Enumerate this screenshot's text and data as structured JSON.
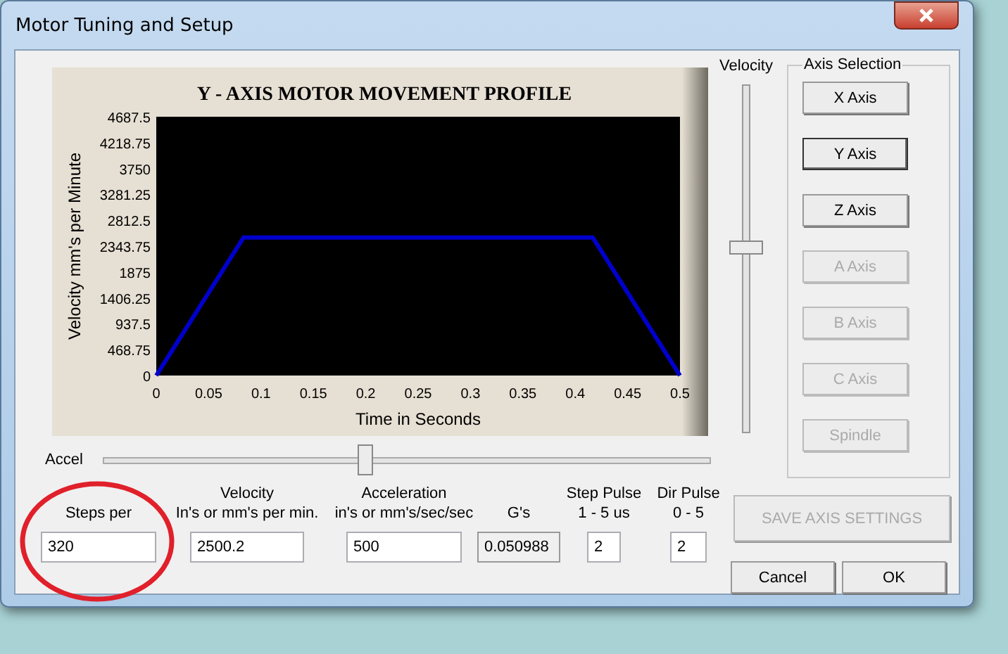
{
  "window": {
    "title": "Motor Tuning and Setup"
  },
  "chart": {
    "chart_data": {
      "type": "line",
      "title": "Y - AXIS MOTOR MOVEMENT PROFILE",
      "xlabel": "Time in Seconds",
      "ylabel": "Velocity mm's per Minute",
      "x": [
        0,
        0.0833,
        0.4167,
        0.5
      ],
      "series": [
        {
          "color": "#0000cc",
          "values": [
            0,
            2500,
            2500,
            0
          ]
        }
      ],
      "xlim": [
        0,
        0.5
      ],
      "ylim": [
        0,
        4687.5
      ],
      "xticks": [
        0,
        0.05,
        0.1,
        0.15,
        0.2,
        0.25,
        0.3,
        0.35,
        0.4,
        0.45,
        0.5
      ],
      "yticks": [
        0,
        468.75,
        937.5,
        1406.25,
        1875,
        2343.75,
        2812.5,
        3281.25,
        3750,
        4218.75,
        4687.5
      ]
    }
  },
  "velocity_slider": {
    "label": "Velocity",
    "level": 0.53
  },
  "accel_slider": {
    "label": "Accel",
    "level": 0.43
  },
  "axis_selection": {
    "title": "Axis Selection",
    "buttons": [
      {
        "label": "X Axis",
        "selected": false,
        "disabled": false
      },
      {
        "label": "Y Axis",
        "selected": true,
        "disabled": false
      },
      {
        "label": "Z Axis",
        "selected": false,
        "disabled": false
      },
      {
        "label": "A Axis",
        "selected": false,
        "disabled": true
      },
      {
        "label": "B Axis",
        "selected": false,
        "disabled": true
      },
      {
        "label": "C Axis",
        "selected": false,
        "disabled": true
      },
      {
        "label": "Spindle",
        "selected": false,
        "disabled": true
      }
    ]
  },
  "fields": [
    {
      "label": "Steps per",
      "value": "320",
      "kind": "input"
    },
    {
      "label": "Velocity\nIn's or mm's per min.",
      "value": "2500.2",
      "kind": "input"
    },
    {
      "label": "Acceleration\nin's or mm's/sec/sec",
      "value": "500",
      "kind": "input"
    },
    {
      "label": "G's",
      "value": "0.050988",
      "kind": "readonly"
    },
    {
      "label": "Step Pulse\n1 - 5 us",
      "value": "2",
      "kind": "input"
    },
    {
      "label": "Dir Pulse\n0 - 5",
      "value": "2",
      "kind": "input"
    }
  ],
  "save_button": {
    "label": "SAVE AXIS SETTINGS",
    "disabled": true
  },
  "buttons": [
    "Cancel",
    "OK"
  ]
}
